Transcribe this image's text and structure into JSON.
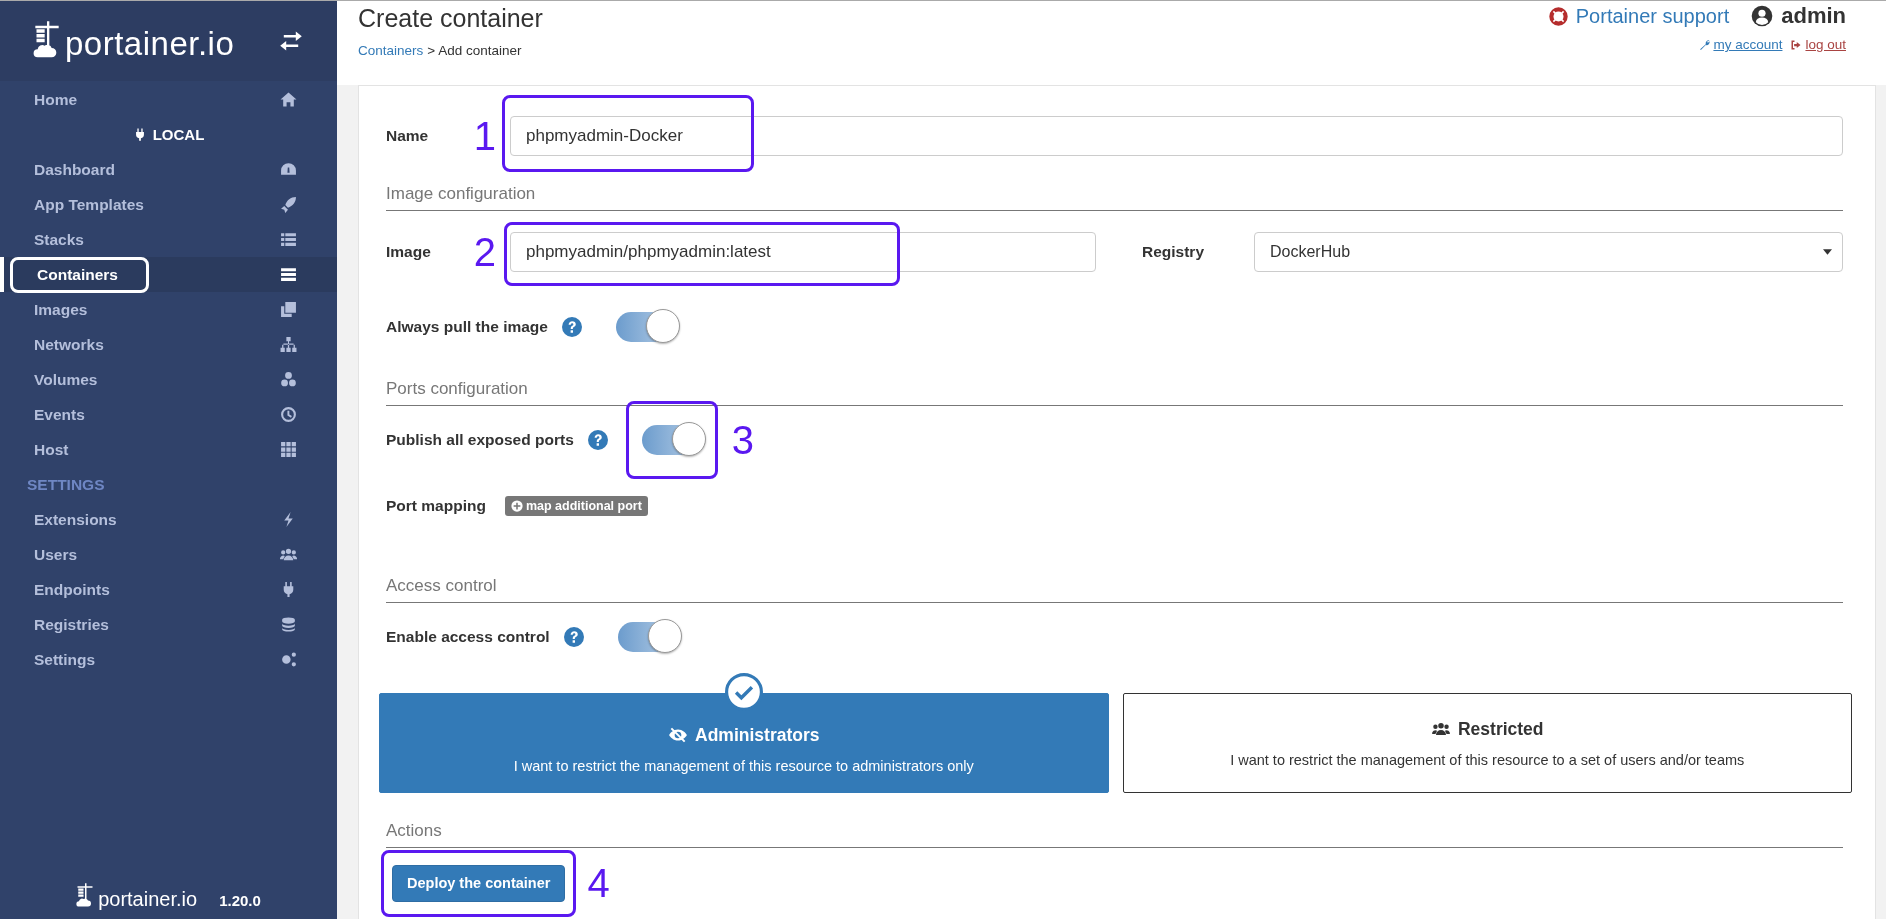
{
  "sidebar": {
    "brand": "portainer.io",
    "items": [
      {
        "kind": "item",
        "label": "Home",
        "selected": false,
        "outlined": false
      },
      {
        "kind": "endpoint",
        "label": "LOCAL"
      },
      {
        "kind": "item",
        "label": "Dashboard",
        "selected": false,
        "outlined": false
      },
      {
        "kind": "item",
        "label": "App Templates",
        "selected": false,
        "outlined": false
      },
      {
        "kind": "item",
        "label": "Stacks",
        "selected": false,
        "outlined": false
      },
      {
        "kind": "item",
        "label": "Containers",
        "selected": true,
        "outlined": true
      },
      {
        "kind": "item",
        "label": "Images",
        "selected": false,
        "outlined": false
      },
      {
        "kind": "item",
        "label": "Networks",
        "selected": false,
        "outlined": false
      },
      {
        "kind": "item",
        "label": "Volumes",
        "selected": false,
        "outlined": false
      },
      {
        "kind": "item",
        "label": "Events",
        "selected": false,
        "outlined": false
      },
      {
        "kind": "item",
        "label": "Host",
        "selected": false,
        "outlined": false
      },
      {
        "kind": "heading",
        "label": "SETTINGS"
      },
      {
        "kind": "item",
        "label": "Extensions",
        "selected": false,
        "outlined": false
      },
      {
        "kind": "item",
        "label": "Users",
        "selected": false,
        "outlined": false
      },
      {
        "kind": "item",
        "label": "Endpoints",
        "selected": false,
        "outlined": false
      },
      {
        "kind": "item",
        "label": "Registries",
        "selected": false,
        "outlined": false
      },
      {
        "kind": "item",
        "label": "Settings",
        "selected": false,
        "outlined": false
      }
    ],
    "footer": {
      "brand": "portainer.io",
      "version": "1.20.0"
    }
  },
  "header": {
    "title": "Create container",
    "breadcrumb_link": "Containers",
    "breadcrumb_current": "> Add container",
    "support": "Portainer support",
    "user": "admin",
    "my_account": "my account",
    "log_out": "log out"
  },
  "form": {
    "name": {
      "label": "Name",
      "value": "phpmyadmin-Docker",
      "annotation": "1"
    },
    "image_section": "Image configuration",
    "image": {
      "label": "Image",
      "value": "phpmyadmin/phpmyadmin:latest",
      "annotation": "2"
    },
    "registry": {
      "label": "Registry",
      "value": "DockerHub"
    },
    "always_pull": {
      "label": "Always pull the image",
      "on": true
    },
    "ports_section": "Ports configuration",
    "publish_ports": {
      "label": "Publish all exposed ports",
      "on": true,
      "annotation": "3"
    },
    "port_mapping": {
      "label": "Port mapping",
      "button": "map additional port"
    },
    "access_section": "Access control",
    "access_control": {
      "label": "Enable access control",
      "on": true
    },
    "access_options": [
      {
        "title": "Administrators",
        "description": "I want to restrict the management of this resource to administrators only",
        "selected": true
      },
      {
        "title": "Restricted",
        "description": "I want to restrict the management of this resource to a set of users and/or teams",
        "selected": false
      }
    ],
    "actions_section": "Actions",
    "deploy": {
      "label": "Deploy the container",
      "annotation": "4"
    }
  }
}
